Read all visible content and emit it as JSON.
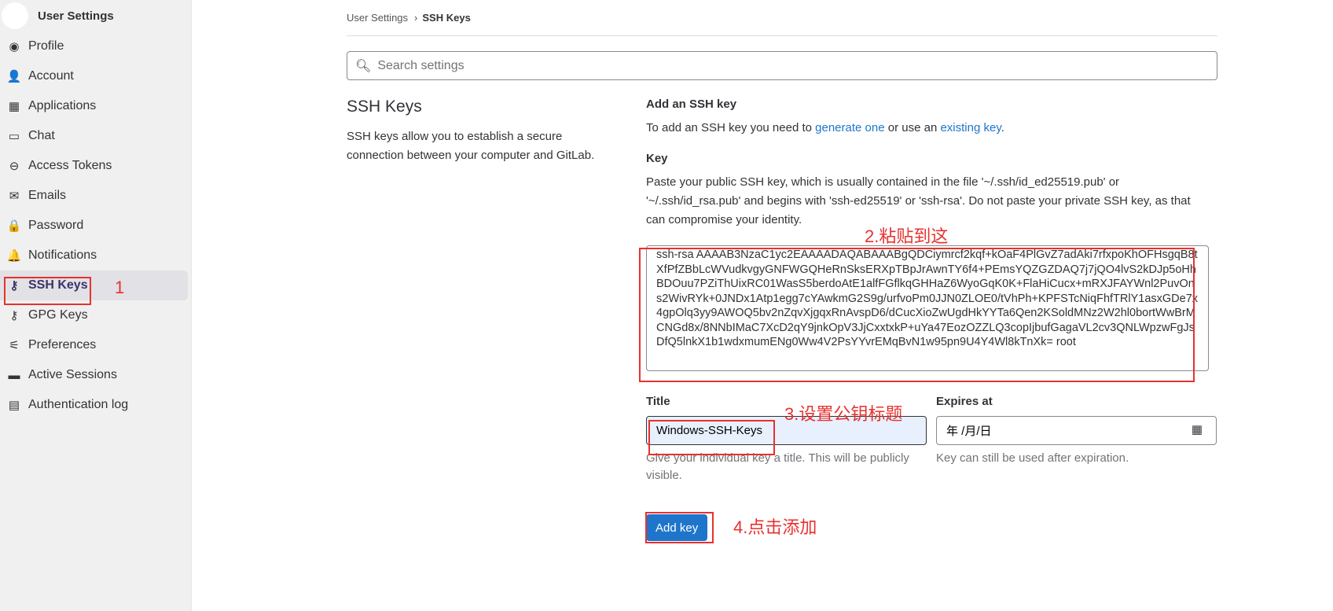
{
  "sidebar": {
    "title": "User Settings",
    "items": [
      {
        "label": "Profile",
        "icon": "profile-icon",
        "glyph": "◉"
      },
      {
        "label": "Account",
        "icon": "account-icon",
        "glyph": "👤"
      },
      {
        "label": "Applications",
        "icon": "applications-icon",
        "glyph": "▦"
      },
      {
        "label": "Chat",
        "icon": "chat-icon",
        "glyph": "▭"
      },
      {
        "label": "Access Tokens",
        "icon": "token-icon",
        "glyph": "⊖"
      },
      {
        "label": "Emails",
        "icon": "email-icon",
        "glyph": "✉"
      },
      {
        "label": "Password",
        "icon": "lock-icon",
        "glyph": "🔒"
      },
      {
        "label": "Notifications",
        "icon": "bell-icon",
        "glyph": "🔔"
      },
      {
        "label": "SSH Keys",
        "icon": "key-icon",
        "glyph": "⚷",
        "active": true
      },
      {
        "label": "GPG Keys",
        "icon": "key-icon",
        "glyph": "⚷"
      },
      {
        "label": "Preferences",
        "icon": "preferences-icon",
        "glyph": "⚟"
      },
      {
        "label": "Active Sessions",
        "icon": "monitor-icon",
        "glyph": "▬"
      },
      {
        "label": "Authentication log",
        "icon": "log-icon",
        "glyph": "▤"
      }
    ]
  },
  "breadcrumb": [
    "User Settings",
    "SSH Keys"
  ],
  "search": {
    "placeholder": "Search settings"
  },
  "section": {
    "title": "SSH Keys",
    "description": "SSH keys allow you to establish a secure connection between your computer and GitLab."
  },
  "form": {
    "heading": "Add an SSH key",
    "intro_prefix": "To add an SSH key you need to ",
    "intro_link1": "generate one",
    "intro_mid": " or use an ",
    "intro_link2": "existing key",
    "intro_suffix": ".",
    "key_label": "Key",
    "key_help": "Paste your public SSH key, which is usually contained in the file '~/.ssh/id_ed25519.pub' or '~/.ssh/id_rsa.pub' and begins with 'ssh-ed25519' or 'ssh-rsa'. Do not paste your private SSH key, as that can compromise your identity.",
    "key_value": "ssh-rsa AAAAB3NzaC1yc2EAAAADAQABAAABgQDCiymrcf2kqf+kOaF4PlGvZ7adAki7rfxpoKhOFHsgqB8tXfPfZBbLcWVudkvgyGNFWGQHeRnSksERXpTBpJrAwnTY6f4+PEmsYQZGZDAQ7j7jQO4lvS2kDJp5oHhBDOuu7PZiThUixRC01WasS5berdoAtE1alfFGflkqGHHaZ6WyoGqK0K+FlaHiCucx+mRXJFAYWnl2PuvOns2WivRYk+0JNDx1Atp1egg7cYAwkmG2S9g/urfvoPm0JJN0ZLOE0/tVhPh+KPFSTcNiqFhfTRlY1asxGDe7x4gpOlq3yy9AWOQ5bv2nZqvXjgqxRnAvspD6/dCucXioZwUgdHkYYTa6Qen2KSoldMNz2W2hl0bortWwBrMCNGd8x/8NNbIMaC7XcD2qY9jnkOpV3JjCxxtxkP+uYa47EozOZZLQ3copIjbufGagaVL2cv3QNLWpzwFgJsDfQ5lnkX1b1wdxmumENg0Ww4V2PsYYvrEMqBvN1w95pn9U4Y4Wl8kTnXk= root",
    "title_label": "Title",
    "title_value": "Windows-SSH-Keys",
    "title_help": "Give your individual key a title. This will be publicly visible.",
    "expires_label": "Expires at",
    "expires_value": "年 /月/日",
    "expires_help": "Key can still be used after expiration.",
    "submit": "Add key"
  },
  "annotations": {
    "step1": "1",
    "step2": "2.粘贴到这",
    "step3": "3.设置公钥标题",
    "step4": "4.点击添加",
    "color": "#e8312f"
  }
}
